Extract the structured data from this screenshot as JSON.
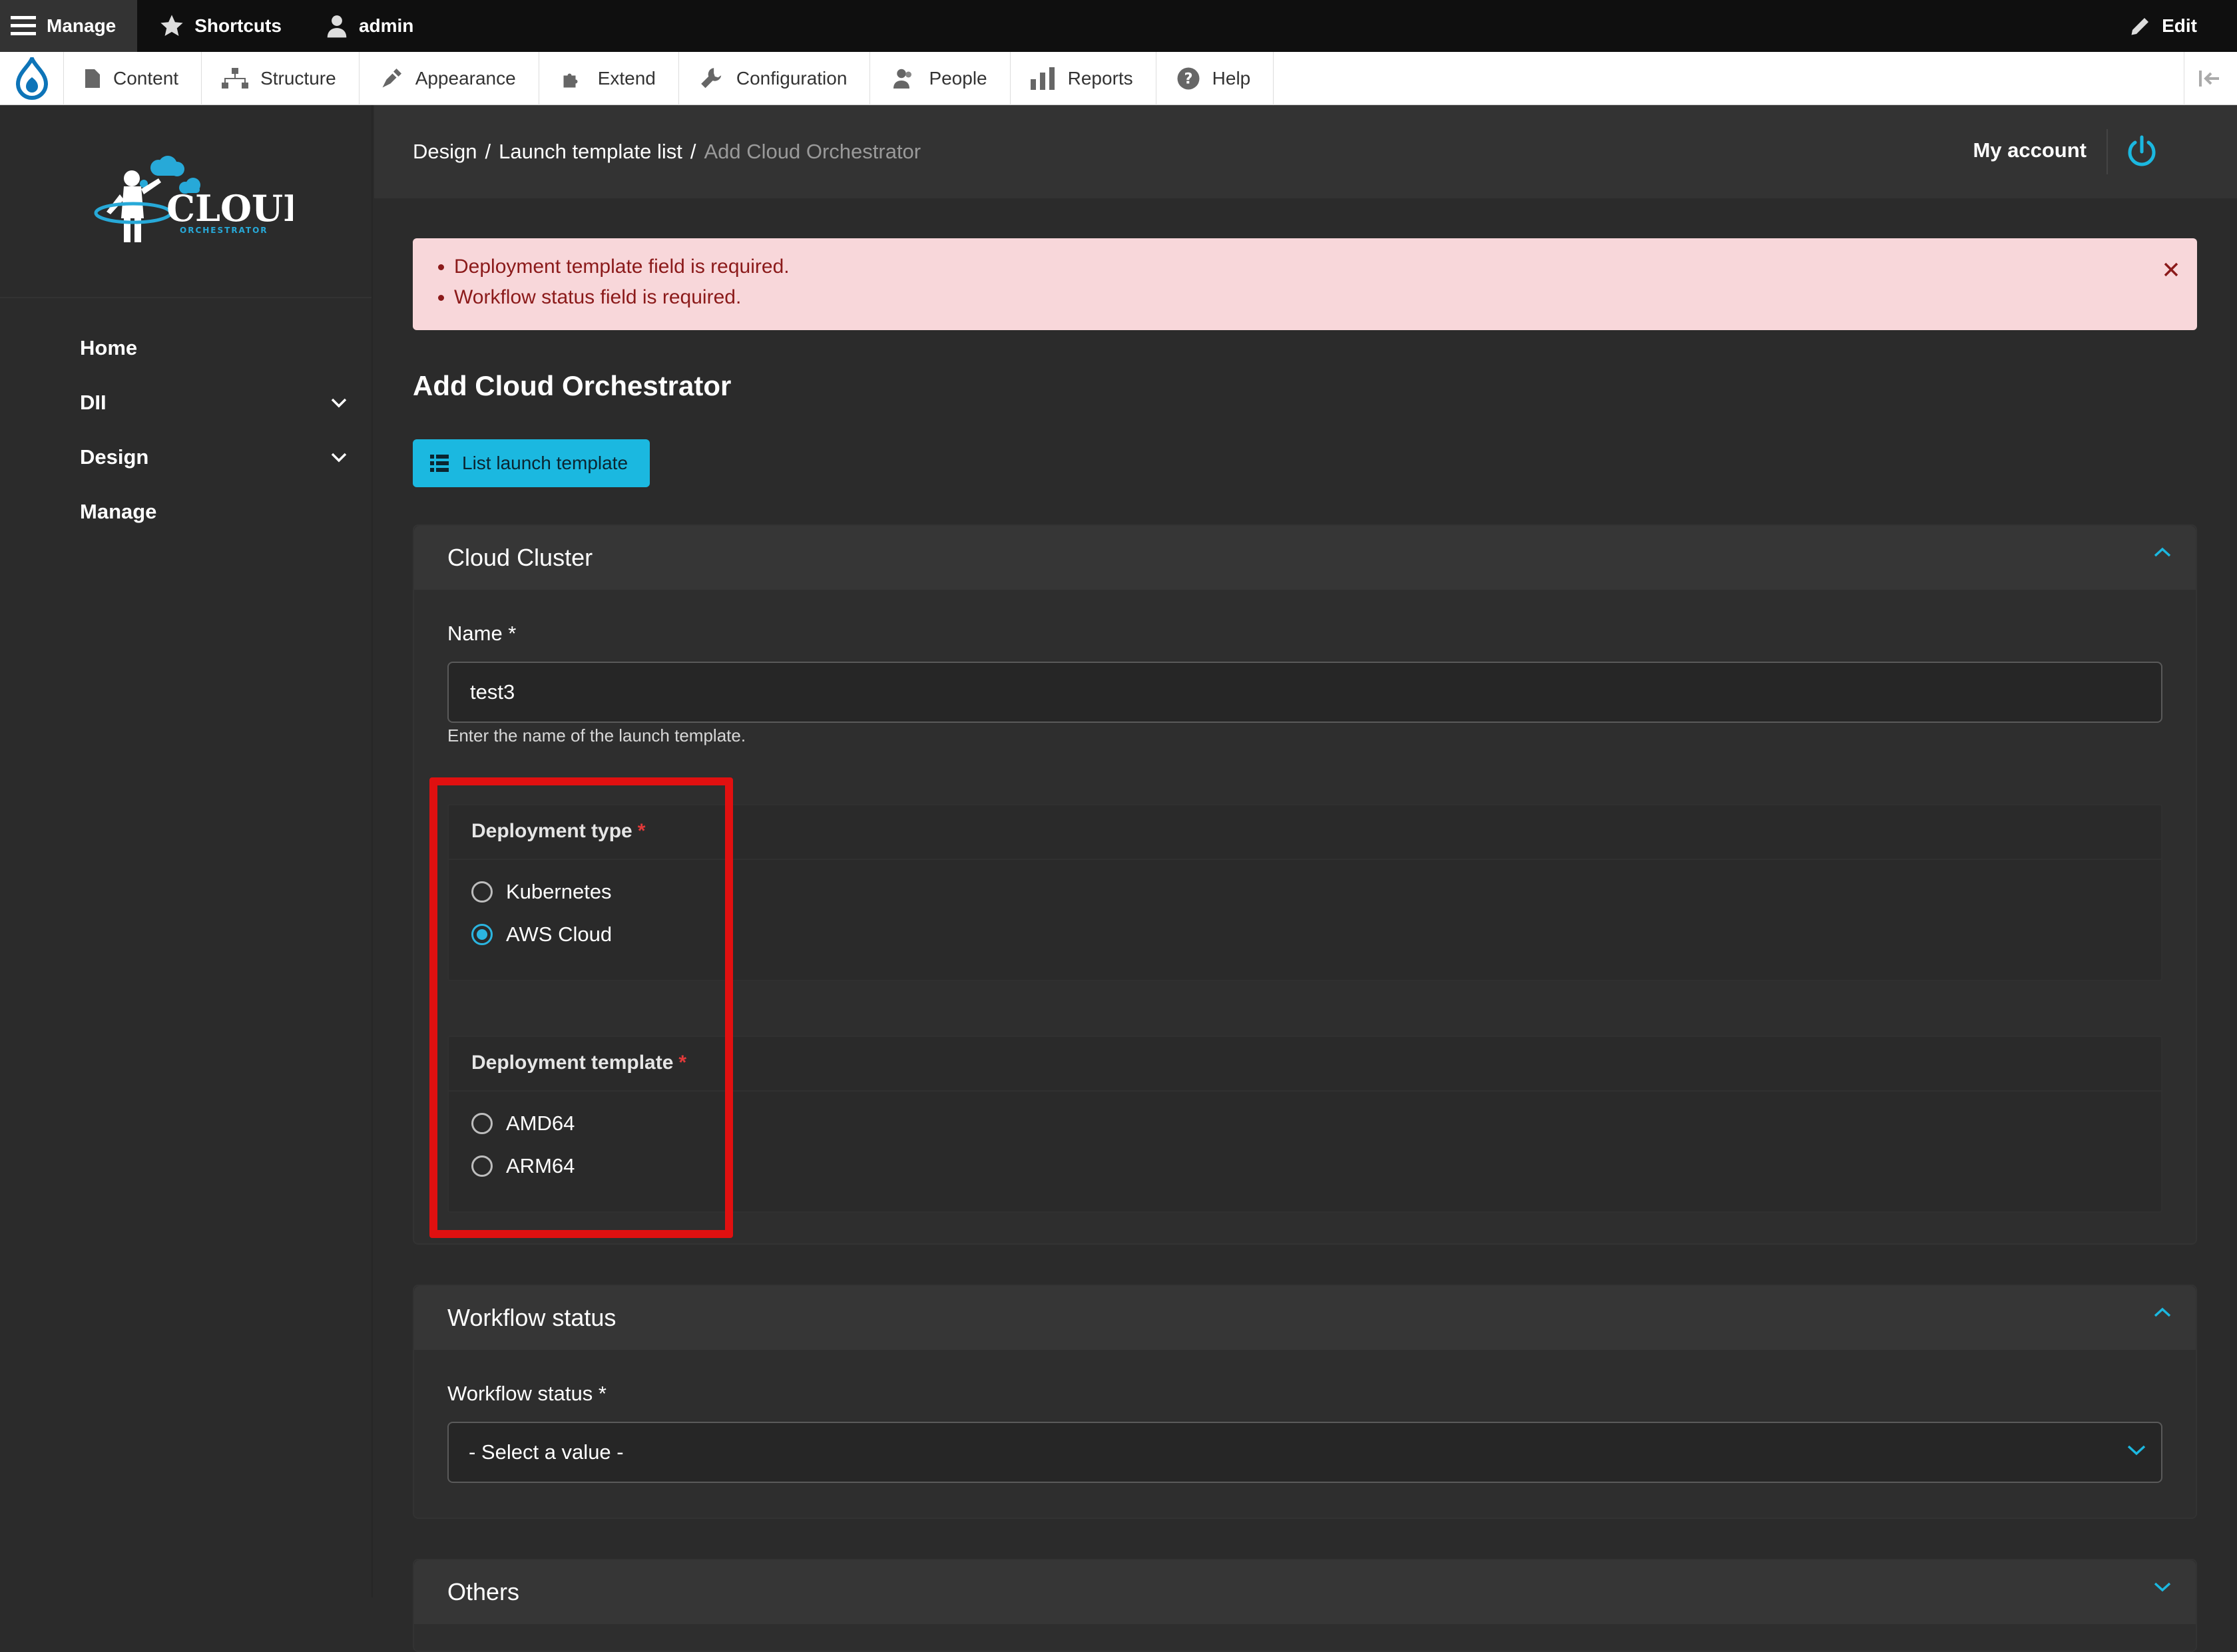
{
  "topbar": {
    "manage": "Manage",
    "shortcuts": "Shortcuts",
    "user": "admin",
    "edit": "Edit"
  },
  "tray": {
    "items": [
      {
        "label": "Content",
        "icon": "file-icon"
      },
      {
        "label": "Structure",
        "icon": "sitemap-icon"
      },
      {
        "label": "Appearance",
        "icon": "paintbrush-icon"
      },
      {
        "label": "Extend",
        "icon": "puzzle-icon"
      },
      {
        "label": "Configuration",
        "icon": "wrench-icon"
      },
      {
        "label": "People",
        "icon": "people-icon"
      },
      {
        "label": "Reports",
        "icon": "bar-chart-icon"
      },
      {
        "label": "Help",
        "icon": "question-icon"
      }
    ]
  },
  "logo": {
    "title": "CLOUD",
    "subtitle": "ORCHESTRATOR"
  },
  "sidebar": {
    "items": [
      {
        "label": "Home",
        "expandable": false
      },
      {
        "label": "DII",
        "expandable": true
      },
      {
        "label": "Design",
        "expandable": true
      },
      {
        "label": "Manage",
        "expandable": false
      }
    ]
  },
  "header": {
    "breadcrumb": [
      "Design",
      "Launch template list",
      "Add Cloud Orchestrator"
    ],
    "account": "My account"
  },
  "alert": {
    "messages": [
      "Deployment template field is required.",
      "Workflow status field is required."
    ]
  },
  "page": {
    "title": "Add Cloud Orchestrator",
    "list_button": "List launch template"
  },
  "cloud_cluster": {
    "heading": "Cloud Cluster",
    "name_label": "Name *",
    "name_value": "test3",
    "name_help": "Enter the name of the launch template.",
    "deployment_type": {
      "legend": "Deployment type",
      "required_mark": "*",
      "options": [
        {
          "label": "Kubernetes",
          "checked": false
        },
        {
          "label": "AWS Cloud",
          "checked": true
        }
      ]
    },
    "deployment_template": {
      "legend": "Deployment template",
      "required_mark": "*",
      "options": [
        {
          "label": "AMD64",
          "checked": false
        },
        {
          "label": "ARM64",
          "checked": false
        }
      ]
    }
  },
  "workflow": {
    "heading": "Workflow status",
    "label": "Workflow status *",
    "select_value": "- Select a value -"
  },
  "others": {
    "heading": "Others"
  },
  "colors": {
    "accent": "#1bb8e0",
    "alert_bg": "#f8d7da",
    "alert_text": "#8b1a1a",
    "highlight": "#e01010"
  }
}
